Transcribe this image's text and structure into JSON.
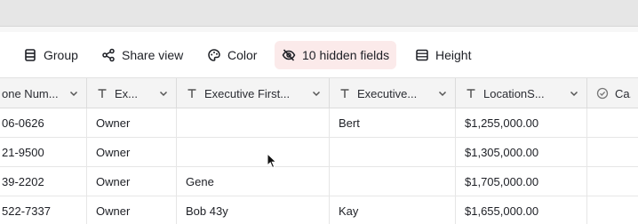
{
  "toolbar": {
    "group_label": "Group",
    "share_label": "Share view",
    "color_label": "Color",
    "hidden_fields_label": "10 hidden fields",
    "height_label": "Height"
  },
  "columns": [
    {
      "label": "one Num...",
      "icon": "phone-icon"
    },
    {
      "label": "Ex...",
      "icon": "text-type-icon"
    },
    {
      "label": "Executive First...",
      "icon": "text-type-icon"
    },
    {
      "label": "Executive...",
      "icon": "text-type-icon"
    },
    {
      "label": "LocationS...",
      "icon": "text-type-icon"
    },
    {
      "label": "Ca...",
      "icon": "checkbox-type-icon"
    }
  ],
  "rows": [
    [
      "06-0626",
      "Owner",
      "",
      "Bert",
      "$1,255,000.00",
      ""
    ],
    [
      "21-9500",
      "Owner",
      "",
      "",
      "$1,305,000.00",
      ""
    ],
    [
      "39-2202",
      "Owner",
      "Gene",
      "",
      "$1,705,000.00",
      ""
    ],
    [
      "522-7337",
      "Owner",
      "Bob 43y",
      "Kay",
      "$1,655,000.00",
      ""
    ]
  ],
  "colors": {
    "active_button_bg": "#fbeaea",
    "header_bg": "#f4f4f4",
    "border": "#dcdcdc"
  }
}
